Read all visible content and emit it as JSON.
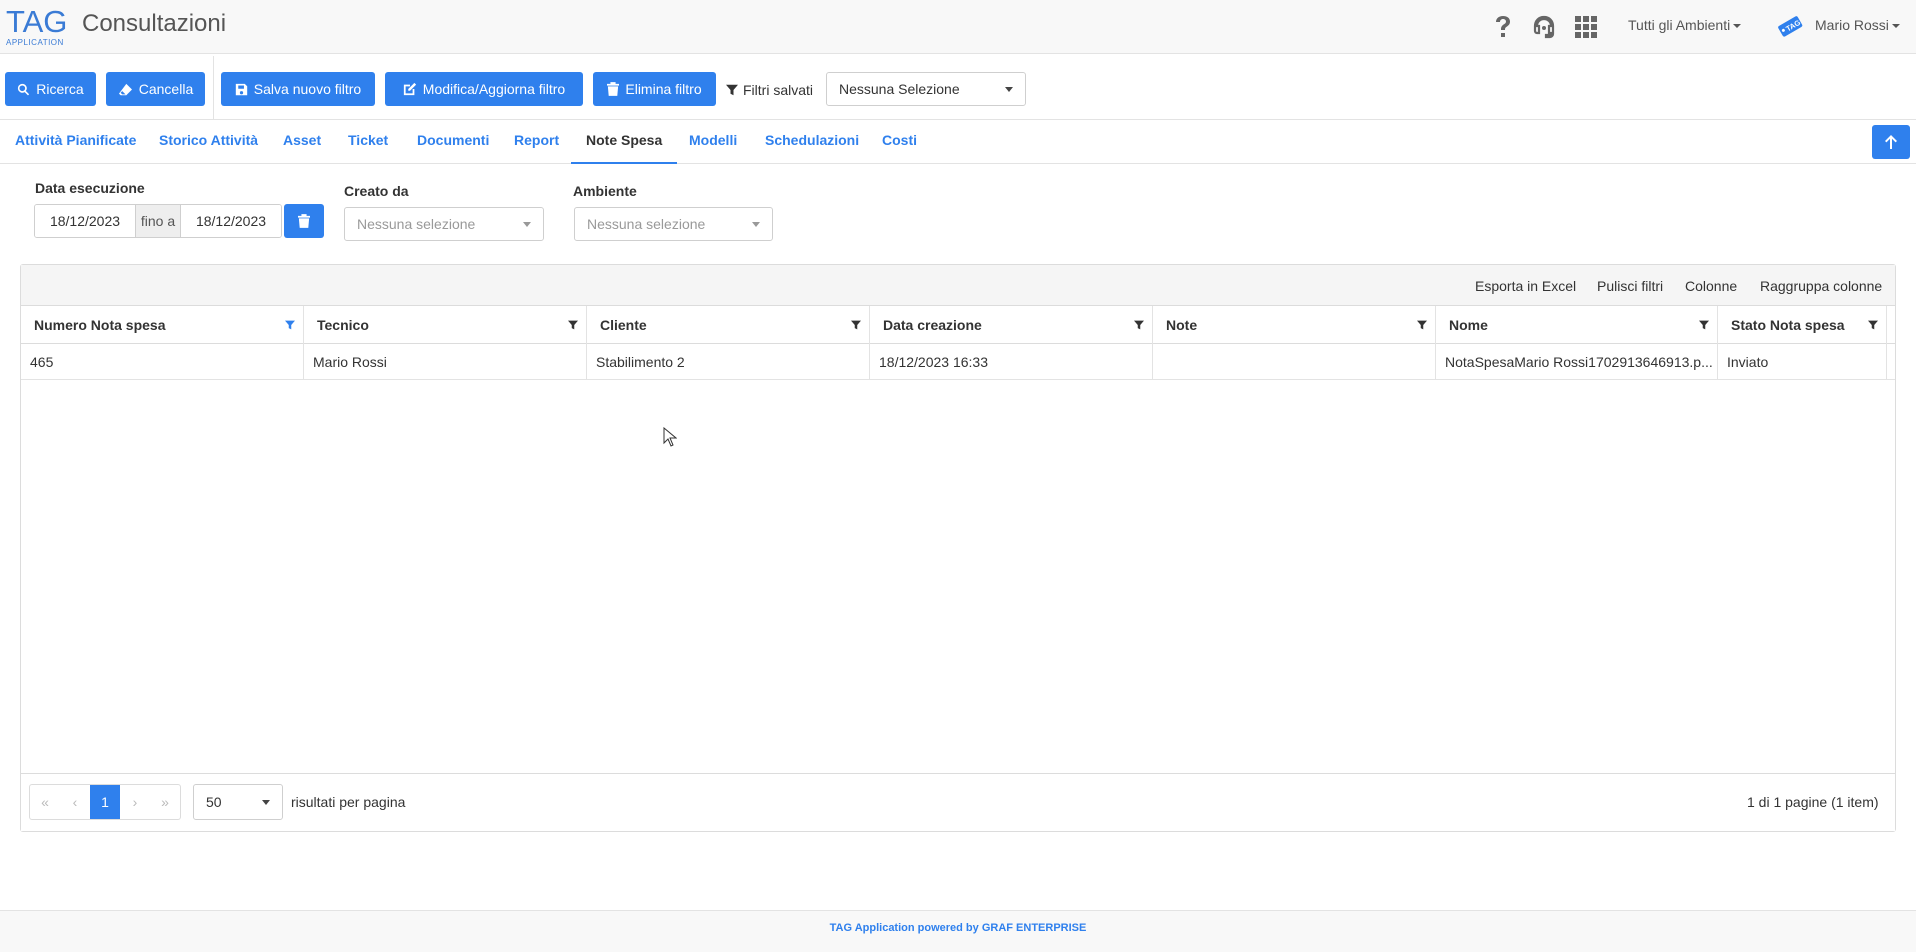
{
  "header": {
    "logo_text": "TAG",
    "logo_sub": "APPLICATION",
    "title": "Consultazioni",
    "ambienti_label": "Tutti gli Ambienti",
    "user_name": "Mario Rossi"
  },
  "toolbar": {
    "ricerca": "Ricerca",
    "cancella": "Cancella",
    "salva": "Salva nuovo filtro",
    "modifica": "Modifica/Aggiorna filtro",
    "elimina": "Elimina filtro",
    "filtri_salvati": "Filtri salvati",
    "filtri_select": "Nessuna Selezione"
  },
  "tabs": [
    {
      "label": "Attività Pianificate"
    },
    {
      "label": "Storico Attività"
    },
    {
      "label": "Asset"
    },
    {
      "label": "Ticket"
    },
    {
      "label": "Documenti"
    },
    {
      "label": "Report"
    },
    {
      "label": "Note Spesa",
      "active": true
    },
    {
      "label": "Modelli"
    },
    {
      "label": "Schedulazioni"
    },
    {
      "label": "Costi"
    }
  ],
  "filters": {
    "data_label": "Data esecuzione",
    "date_from": "18/12/2023",
    "date_sep": "fino a",
    "date_to": "18/12/2023",
    "creato_label": "Creato da",
    "creato_value": "Nessuna selezione",
    "ambiente_label": "Ambiente",
    "ambiente_value": "Nessuna selezione"
  },
  "grid": {
    "toolbar": {
      "export": "Esporta in Excel",
      "clear": "Pulisci filtri",
      "columns": "Colonne",
      "group": "Raggruppa colonne"
    },
    "columns": [
      "Numero Nota spesa",
      "Tecnico",
      "Cliente",
      "Data creazione",
      "Note",
      "Nome",
      "Stato Nota spesa"
    ],
    "rows": [
      [
        "465",
        "Mario Rossi",
        "Stabilimento 2",
        "18/12/2023 16:33",
        "",
        "NotaSpesaMario Rossi1702913646913.p...",
        "Inviato"
      ]
    ],
    "pager": {
      "current_page": "1",
      "page_size": "50",
      "per_page_label": "risultati per pagina",
      "summary": "1 di 1 pagine (1 item)"
    }
  },
  "footer": {
    "text": "TAG Application powered by GRAF ENTERPRISE"
  },
  "colors": {
    "primary": "#2f80ed"
  }
}
